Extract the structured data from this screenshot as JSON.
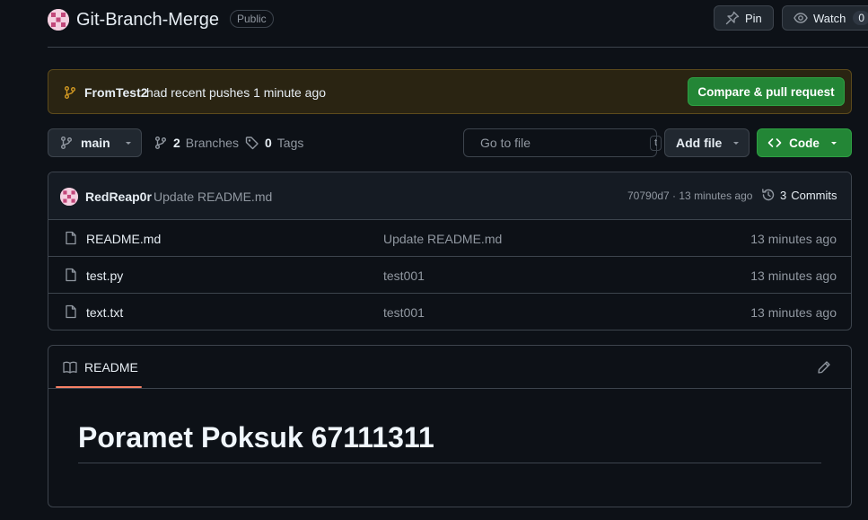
{
  "repo": {
    "name": "Git-Branch-Merge",
    "visibility": "Public",
    "pin_label": "Pin",
    "watch_label": "Watch",
    "watch_count": "0"
  },
  "banner": {
    "branch": "FromTest2",
    "message": "had recent pushes 1 minute ago",
    "button_label": "Compare & pull request",
    "accent": "#d29922"
  },
  "toolbar": {
    "branch_label": "main",
    "branches_count": "2",
    "branches_label": "Branches",
    "tags_count": "0",
    "tags_label": "Tags",
    "search_placeholder": "Go to file",
    "search_shortcut": "t",
    "add_file_label": "Add file",
    "code_label": "Code"
  },
  "latest_commit": {
    "author": "RedReap0r",
    "message": "Update README.md",
    "hash_time": "70790d7 · 13 minutes ago",
    "commits_count": "3",
    "commits_label": "Commits"
  },
  "files": [
    {
      "name": "README.md",
      "message": "Update README.md",
      "time": "13 minutes ago",
      "icon": "file-icon"
    },
    {
      "name": "test.py",
      "message": "test001",
      "time": "13 minutes ago",
      "icon": "file-icon"
    },
    {
      "name": "text.txt",
      "message": "test001",
      "time": "13 minutes ago",
      "icon": "file-icon"
    }
  ],
  "readme": {
    "tab_label": "README",
    "heading": "Poramet Poksuk 67111311",
    "tab_accent": "#f78166"
  },
  "colors": {
    "background": "#0d1117",
    "green": "#238636",
    "border": "#3d444d"
  }
}
